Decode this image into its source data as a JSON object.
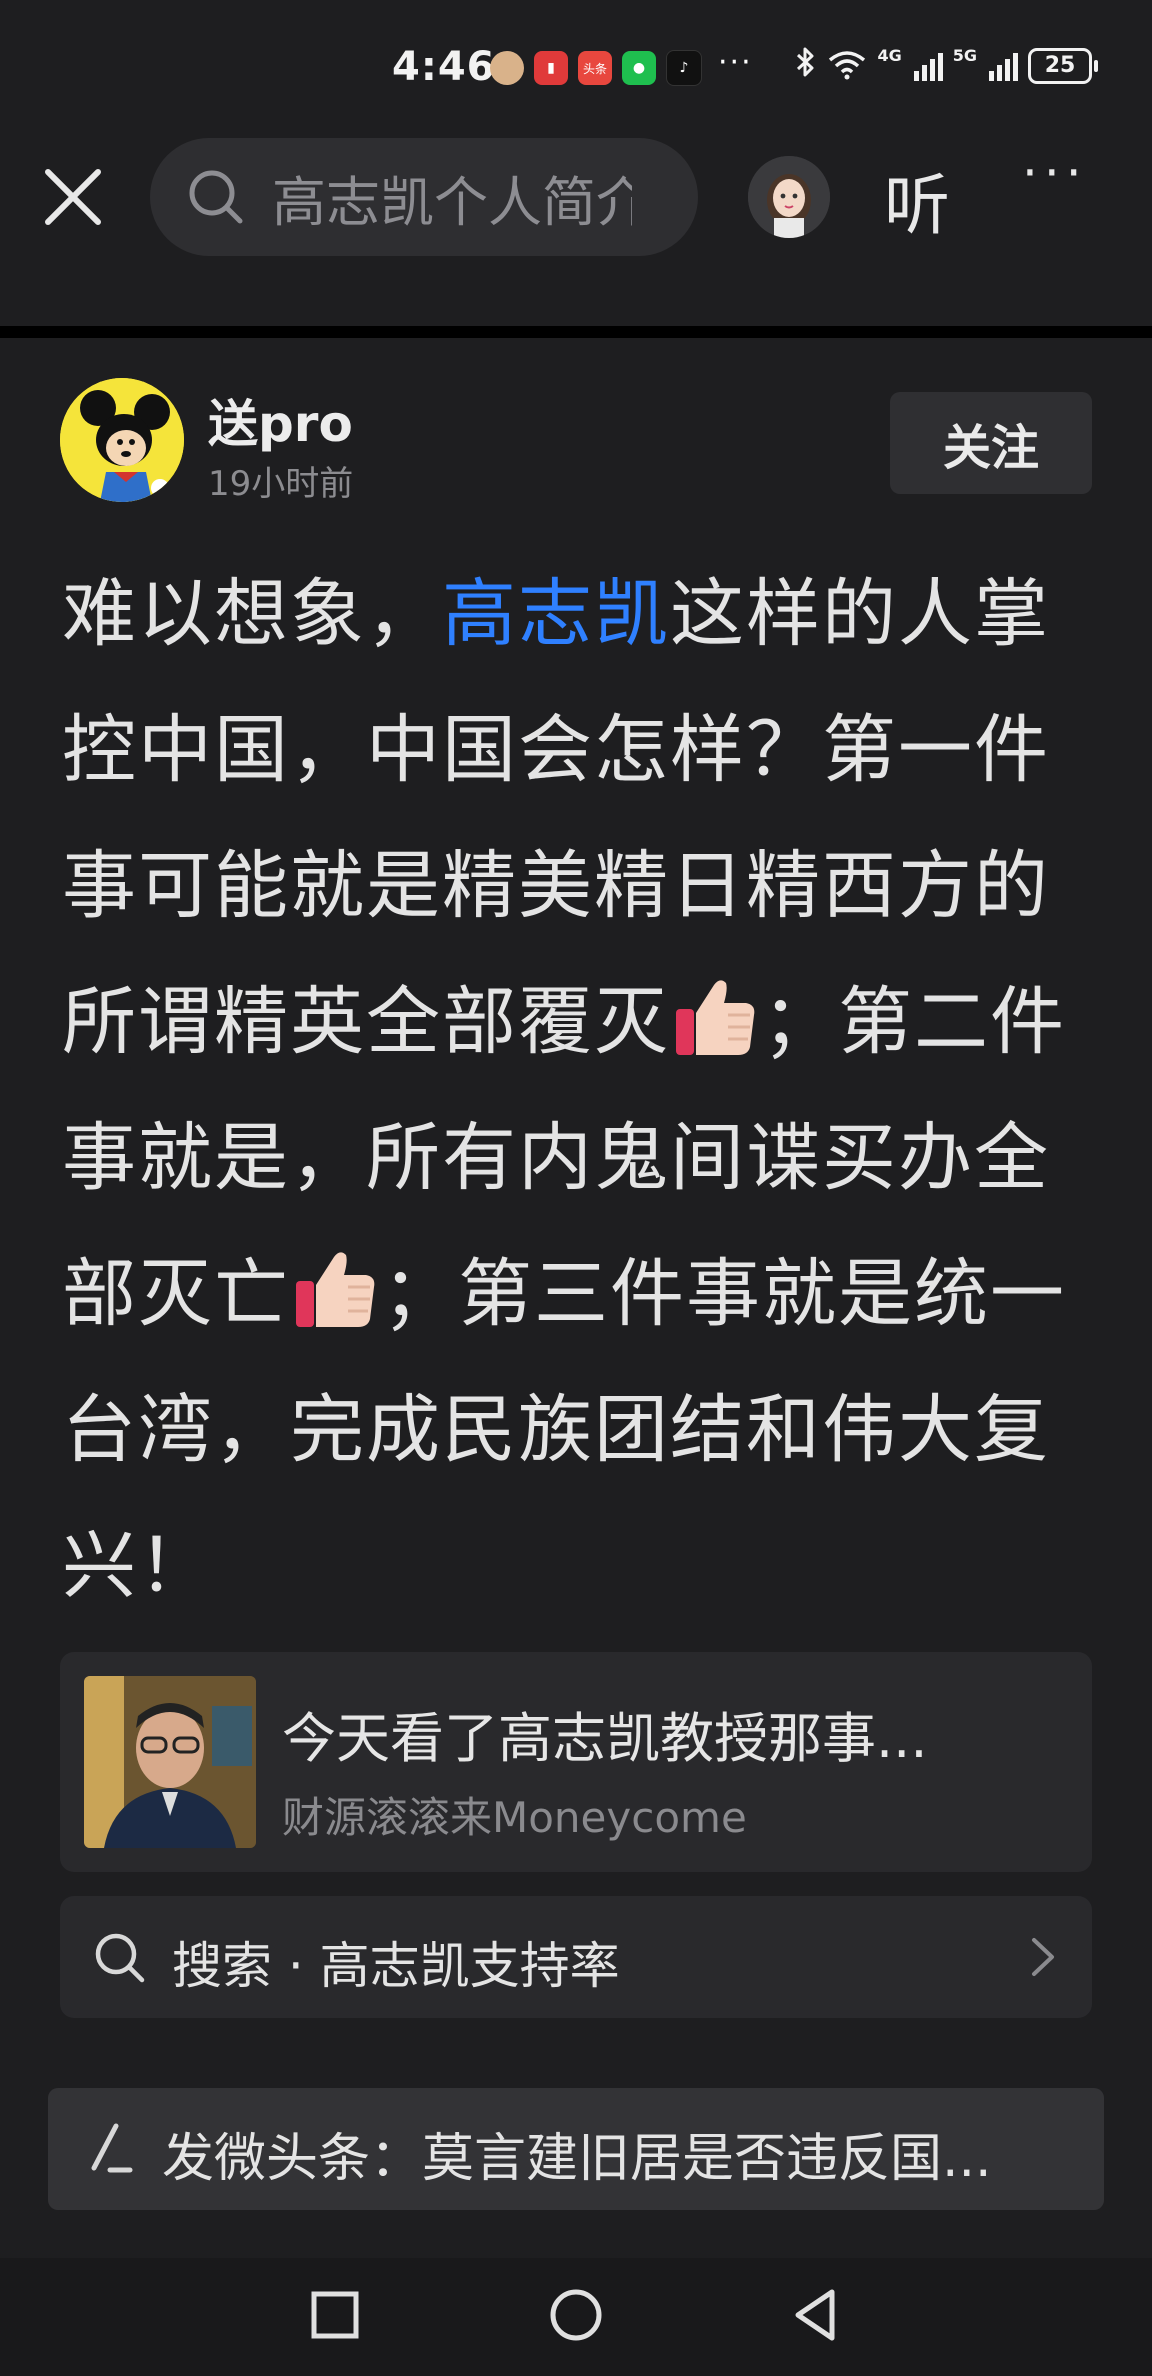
{
  "status_bar": {
    "time": "4:46",
    "notification_icons": [
      "avatar-icon",
      "red-book-icon",
      "toutiao-icon",
      "wechat-icon",
      "tiktok-icon"
    ],
    "toutiao_label": "头条",
    "more_notifications": "···",
    "network_1": "4G",
    "network_2": "5G",
    "battery": "25"
  },
  "top_nav": {
    "search_placeholder": "高志凯个人简介",
    "listen_label": "听",
    "more_label": "···"
  },
  "post": {
    "author_name": "送pro",
    "time_ago": "19小时前",
    "follow_label": "关注",
    "body_prefix": "难以想象，",
    "topic": "高志凯",
    "body_part1": "这样的人掌控中国，中国会怎样？第一件事可能就是精美精日精西方的所谓精英全部覆灭",
    "body_part2": "；第二件事就是，所有内鬼间谍买办全部灭亡",
    "body_part3": "；第三件事就是统一台湾，完成民族团结和伟大复兴！"
  },
  "link_card": {
    "title": "今天看了高志凯教授那事...",
    "source": "财源滚滚来Moneycome"
  },
  "search_suggestion": {
    "text": "搜索 · 高志凯支持率"
  },
  "compose_bar": {
    "text": "发微头条：莫言建旧居是否违反国..."
  },
  "colors": {
    "background": "#1e1e20",
    "topic_link": "#2f80ff",
    "card_background": "#29292c"
  }
}
